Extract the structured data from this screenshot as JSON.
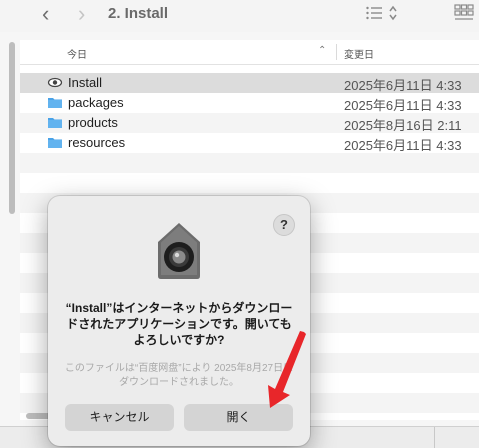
{
  "window": {
    "title": "2. Install",
    "back_glyph": "‹",
    "forward_glyph": "›"
  },
  "toolbar": {
    "icons": [
      "chevron-left-icon",
      "chevron-right-icon",
      "list-view-icon",
      "updown-icon",
      "grid-view-icon"
    ]
  },
  "list": {
    "header": {
      "name": "今日",
      "date": "変更日",
      "sort_glyph": "⌃"
    },
    "rows": [
      {
        "name": "Install",
        "date": "2025年6月11日 4:33",
        "icon": "app-eye-icon",
        "selected": true
      },
      {
        "name": "packages",
        "date": "2025年6月11日 4:33",
        "icon": "folder-icon"
      },
      {
        "name": "products",
        "date": "2025年8月16日 2:11",
        "icon": "folder-icon"
      },
      {
        "name": "resources",
        "date": "2025年6月11日 4:33",
        "icon": "folder-icon"
      }
    ]
  },
  "dialog": {
    "help": "?",
    "message": "“Install”はインターネットからダウンロードされたアプリケーションです。開いてもよろしいですか?",
    "detail": "このファイルは“百度网盘”により 2025年8月27日にダウンロードされました。",
    "cancel_label": "キャンセル",
    "open_label": "開く",
    "icon": "gatekeeper-shield-icon"
  },
  "colors": {
    "folder": "#4aa3e8",
    "arrow": "#e8262a"
  }
}
